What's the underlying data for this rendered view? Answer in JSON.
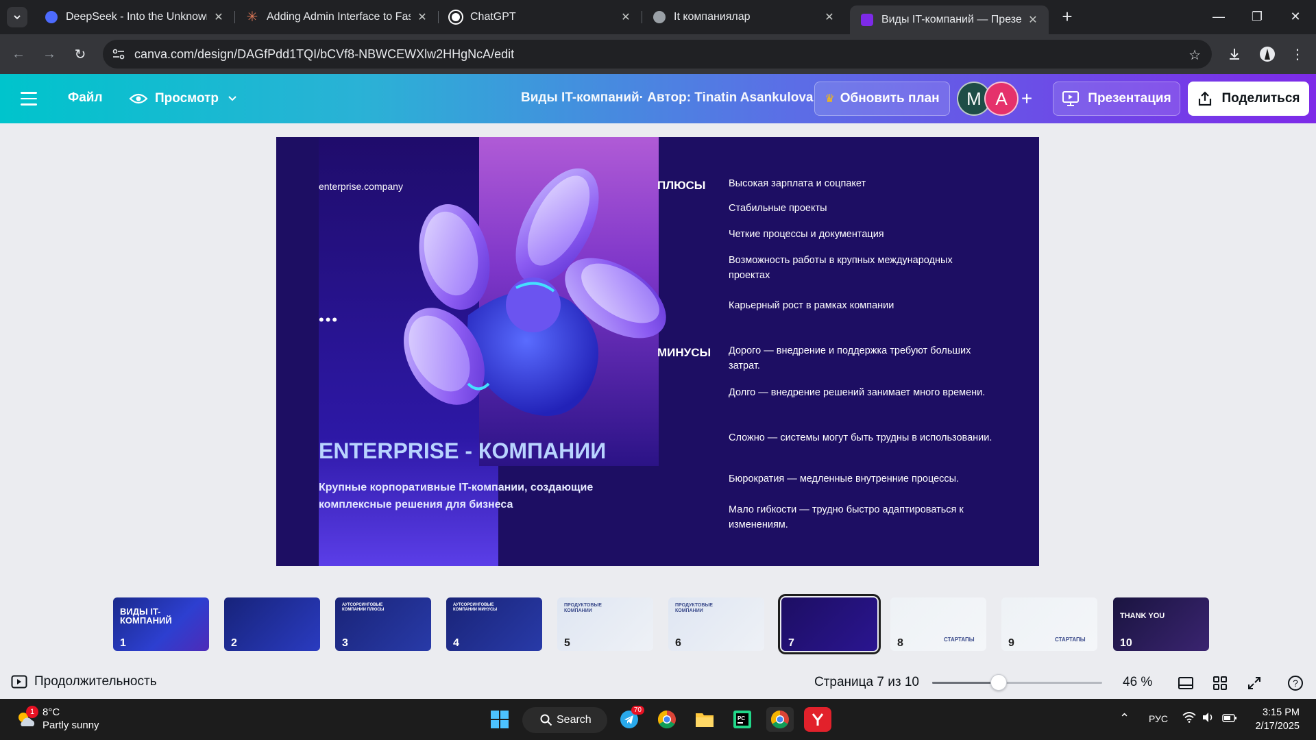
{
  "browser": {
    "tabs": [
      {
        "title": "DeepSeek - Into the Unknown",
        "favicon": "deepseek-icon",
        "color": "#4d6bfe"
      },
      {
        "title": "Adding Admin Interface to FastA",
        "favicon": "claude-icon",
        "color": "#d97757"
      },
      {
        "title": "ChatGPT",
        "favicon": "chatgpt-icon",
        "color": "#ffffff"
      },
      {
        "title": "It компаниялар",
        "favicon": "globe-icon",
        "color": "#9aa0a6"
      },
      {
        "title": "Виды IT-компаний — Презента",
        "favicon": "canva-icon",
        "color": "#7d2ae8"
      }
    ],
    "url": "canva.com/design/DAGfPdd1TQI/bCVf8-NBWCEWXlw2HHgNcA/edit"
  },
  "canva": {
    "file_label": "Файл",
    "view_label": "Просмотр",
    "design_title": "Виды IT-компаний· Автор: Tinatin Asankulova",
    "upgrade_label": "Обновить план",
    "avatars": [
      {
        "letter": "M",
        "color": "#1e4d47"
      },
      {
        "letter": "A",
        "color": "#e5316b"
      }
    ],
    "present_label": "Презентация",
    "share_label": "Поделиться",
    "accent_color": "#7d2ae8"
  },
  "slide": {
    "company": "enterprise.company",
    "dots": "•••",
    "heading": "ENTERPRISE - КОМПАНИИ",
    "subtitle": "Крупные корпоративные IT-компании, создающие комплексные решения для бизнеса",
    "pros_label": "ПЛЮСЫ",
    "cons_label": "МИНУСЫ",
    "pros": [
      "Высокая зарплата и соцпакет",
      "Стабильные проекты",
      "Четкие процессы и документация",
      "Возможность работы в крупных международных проектах",
      "Карьерный рост в рамках компании"
    ],
    "cons": [
      "Дорого — внедрение и поддержка требуют больших затрат.",
      "Долго — внедрение решений занимает много времени.",
      "Сложно — системы могут быть трудны в использовании.",
      "Бюрократия — медленные внутренние процессы.",
      "Мало гибкости — трудно быстро адаптироваться к изменениям."
    ]
  },
  "thumbnails": [
    {
      "num": "1",
      "title": "ВИДЫ IT-КОМПАНИЙ",
      "theme": "dark"
    },
    {
      "num": "2",
      "title": "",
      "theme": "dark"
    },
    {
      "num": "3",
      "title": "АУТСОРСИНГОВЫЕ КОМПАНИИ ПЛЮСЫ",
      "theme": "dark"
    },
    {
      "num": "4",
      "title": "АУТСОРСИНГОВЫЕ КОМПАНИИ МИНУСЫ",
      "theme": "dark"
    },
    {
      "num": "5",
      "title": "ПРОДУКТОВЫЕ КОМПАНИИ",
      "theme": "light"
    },
    {
      "num": "6",
      "title": "ПРОДУКТОВЫЕ КОМПАНИИ",
      "theme": "light"
    },
    {
      "num": "7",
      "title": "",
      "theme": "dark"
    },
    {
      "num": "8",
      "title": "СТАРТАПЫ",
      "theme": "light"
    },
    {
      "num": "9",
      "title": "СТАРТАПЫ",
      "theme": "light"
    },
    {
      "num": "10",
      "title": "THANK YOU",
      "theme": "dark"
    }
  ],
  "bottom": {
    "duration_label": "Продолжительность",
    "page_info": "Страница 7 из 10",
    "zoom": "46 %",
    "zoom_fraction": 0.46
  },
  "taskbar": {
    "weather_temp": "8°C",
    "weather_desc": "Partly sunny",
    "weather_badge": "1",
    "search_label": "Search",
    "telegram_badge": "70",
    "lang": "РУС",
    "time": "3:15 PM",
    "date": "2/17/2025"
  }
}
